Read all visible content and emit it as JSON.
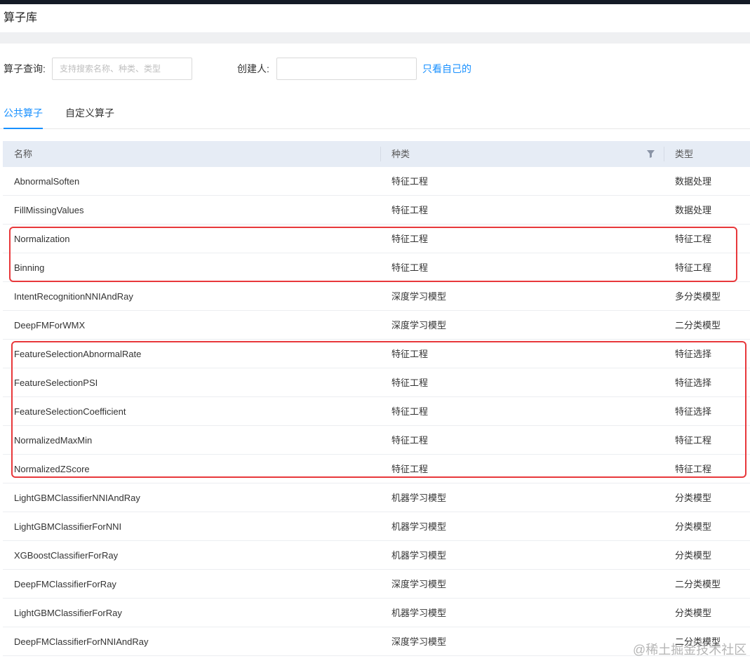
{
  "page": {
    "title": "算子库"
  },
  "filters": {
    "query_label": "算子查询:",
    "query_placeholder": "支持搜索名称、种类、类型",
    "query_value": "",
    "creator_label": "创建人:",
    "creator_value": "",
    "only_mine_label": "只看自己的"
  },
  "tabs": [
    {
      "label": "公共算子",
      "active": true
    },
    {
      "label": "自定义算子",
      "active": false
    }
  ],
  "table": {
    "headers": [
      "名称",
      "种类",
      "类型"
    ],
    "rows": [
      [
        "AbnormalSoften",
        "特征工程",
        "数据处理"
      ],
      [
        "FillMissingValues",
        "特征工程",
        "数据处理"
      ],
      [
        "Normalization",
        "特征工程",
        "特征工程"
      ],
      [
        "Binning",
        "特征工程",
        "特征工程"
      ],
      [
        "IntentRecognitionNNIAndRay",
        "深度学习模型",
        "多分类模型"
      ],
      [
        "DeepFMForWMX",
        "深度学习模型",
        "二分类模型"
      ],
      [
        "FeatureSelectionAbnormalRate",
        "特征工程",
        "特征选择"
      ],
      [
        "FeatureSelectionPSI",
        "特征工程",
        "特征选择"
      ],
      [
        "FeatureSelectionCoefficient",
        "特征工程",
        "特征选择"
      ],
      [
        "NormalizedMaxMin",
        "特征工程",
        "特征工程"
      ],
      [
        "NormalizedZScore",
        "特征工程",
        "特征工程"
      ],
      [
        "LightGBMClassifierNNIAndRay",
        "机器学习模型",
        "分类模型"
      ],
      [
        "LightGBMClassifierForNNI",
        "机器学习模型",
        "分类模型"
      ],
      [
        "XGBoostClassifierForRay",
        "机器学习模型",
        "分类模型"
      ],
      [
        "DeepFMClassifierForRay",
        "深度学习模型",
        "二分类模型"
      ],
      [
        "LightGBMClassifierForRay",
        "机器学习模型",
        "分类模型"
      ],
      [
        "DeepFMClassifierForNNIAndRay",
        "深度学习模型",
        "二分类模型"
      ]
    ]
  },
  "watermark": "@稀土掘金技术社区",
  "colors": {
    "accent": "#1890ff",
    "highlight": "#e8383b",
    "header_bg": "#e6ecf5",
    "topbar": "#141a26"
  }
}
